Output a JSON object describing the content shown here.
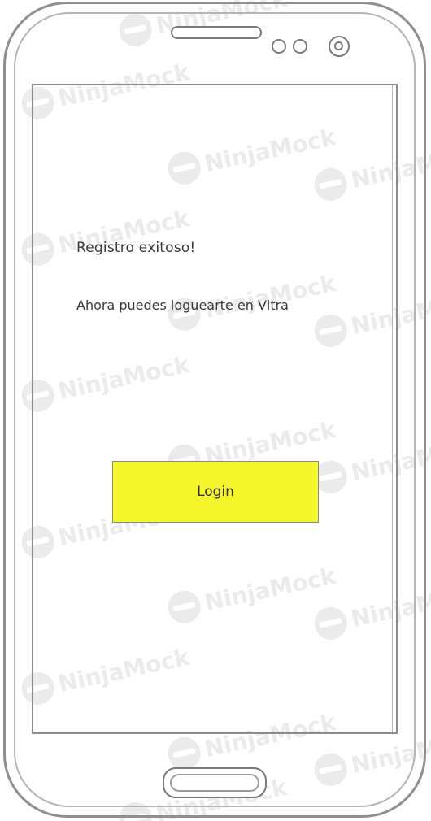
{
  "watermark": {
    "text": "NinjaMock",
    "color": "#ebebeb"
  },
  "screen": {
    "title": "Registro exitoso!",
    "message": "Ahora puedes loguearte en Vltra",
    "login_button": "Login"
  },
  "colors": {
    "button_fill": "#f4f52a",
    "frame_stroke": "#8f8f8f",
    "text": "#3a3a3a"
  },
  "icons": {
    "speaker": "speaker-grille-icon",
    "sensor": "proximity-sensor-icon",
    "camera": "front-camera-icon",
    "home": "home-button-icon"
  }
}
